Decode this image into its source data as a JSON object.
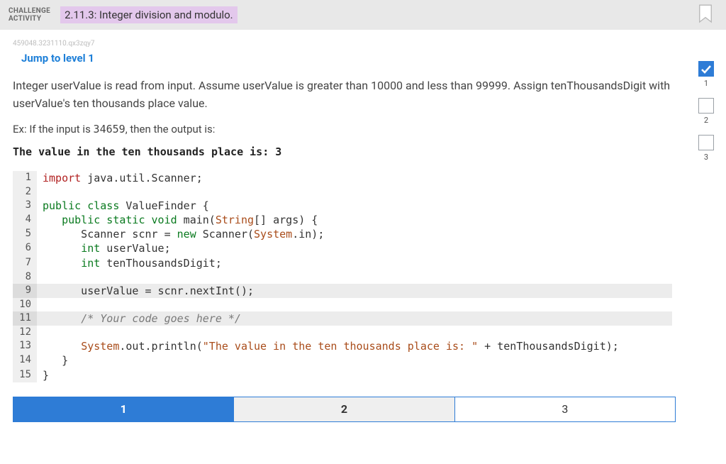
{
  "header": {
    "challenge_label_line1": "CHALLENGE",
    "challenge_label_line2": "ACTIVITY",
    "title": "2.11.3: Integer division and modulo."
  },
  "idcode": "459048.3231110.qx3zqy7",
  "jump_link": "Jump to level 1",
  "prompt": "Integer userValue is read from input. Assume userValue is greater than 10000 and less than 99999. Assign tenThousandsDigit with userValue's ten thousands place value.",
  "example_prefix": "Ex: If the input is ",
  "example_input": "34659",
  "example_suffix": ", then the output is:",
  "example_output": "The value in the ten thousands place is: 3",
  "code": {
    "l1": {
      "n": "1",
      "a": "import",
      "b": " java.util.Scanner;"
    },
    "l2": {
      "n": "2"
    },
    "l3": {
      "n": "3",
      "a": "public class",
      "b": " ValueFinder {"
    },
    "l4": {
      "n": "4",
      "a": "   public static void",
      "b": " main(",
      "c": "String",
      "d": "[] args) {"
    },
    "l5": {
      "n": "5",
      "a": "      Scanner scnr = ",
      "b": "new",
      "c": " Scanner(",
      "d": "System",
      "e": ".in);"
    },
    "l6": {
      "n": "6",
      "a": "      ",
      "b": "int",
      "c": " userValue;"
    },
    "l7": {
      "n": "7",
      "a": "      ",
      "b": "int",
      "c": " tenThousandsDigit;"
    },
    "l8": {
      "n": "8"
    },
    "l9": {
      "n": "9",
      "a": "      userValue = scnr.nextInt();"
    },
    "l10": {
      "n": "10"
    },
    "l11": {
      "n": "11",
      "a": "      ",
      "b": "/* Your code goes here */"
    },
    "l12": {
      "n": "12"
    },
    "l13": {
      "n": "13",
      "a": "      ",
      "b": "System",
      "c": ".out.println(",
      "d": "\"The value in the ten thousands place is: \"",
      "e": " + tenThousandsDigit);"
    },
    "l14": {
      "n": "14",
      "a": "   }"
    },
    "l15": {
      "n": "15",
      "a": "}"
    }
  },
  "progress": {
    "step1": "1",
    "step2": "2",
    "step3": "3"
  },
  "tabs": {
    "t1": "1",
    "t2": "2",
    "t3": "3"
  }
}
